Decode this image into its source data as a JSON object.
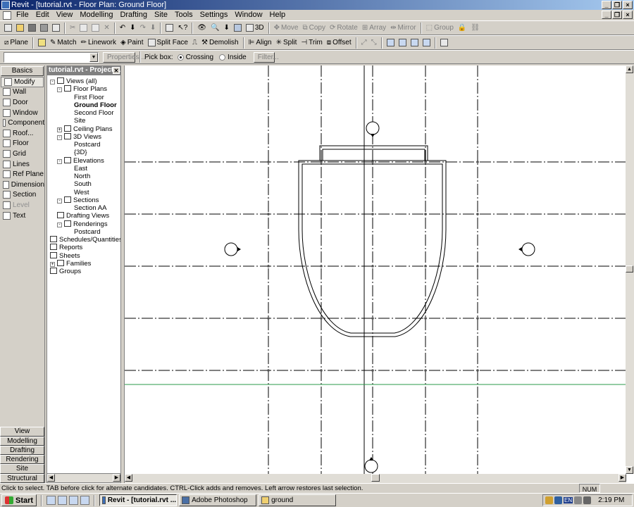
{
  "window": {
    "title": "Revit - [tutorial.rvt - Floor Plan: Ground Floor]"
  },
  "menu": [
    "File",
    "Edit",
    "View",
    "Modelling",
    "Drafting",
    "Site",
    "Tools",
    "Settings",
    "Window",
    "Help"
  ],
  "toolbar1": {
    "items": [
      "Move",
      "Copy",
      "Rotate",
      "Array",
      "Mirror",
      "Group"
    ],
    "view3d": "3D"
  },
  "toolbar2": {
    "items": [
      "Plane",
      "Match",
      "Linework",
      "Paint",
      "Split Face",
      "Demolish",
      "Align",
      "Split",
      "Trim",
      "Offset"
    ]
  },
  "optionsbar": {
    "type_selector": "",
    "properties_label": "Properties...",
    "pickbox_label": "Pick box:",
    "crossing_label": "Crossing",
    "inside_label": "Inside",
    "crossing_selected": true,
    "filter_label": "Filter..."
  },
  "design_bar": {
    "header": "Basics",
    "tools": [
      "Modify",
      "Wall",
      "Door",
      "Window",
      "Component",
      "Roof...",
      "Floor",
      "Grid",
      "Lines",
      "Ref Plane",
      "Dimension",
      "Section",
      "Level",
      "Text"
    ],
    "selected_tool": "Modify",
    "disabled_tools": [
      "Level"
    ],
    "tabs": [
      "View",
      "Modelling",
      "Drafting",
      "Rendering",
      "Site",
      "Structural"
    ]
  },
  "project_browser": {
    "title": "tutorial.rvt - Project ...",
    "tree": [
      {
        "label": "Views (all)",
        "level": 0,
        "toggle": "-",
        "active": false
      },
      {
        "label": "Floor Plans",
        "level": 1,
        "toggle": "-",
        "active": false
      },
      {
        "label": "First Floor",
        "level": 2,
        "toggle": "",
        "active": false
      },
      {
        "label": "Ground Floor",
        "level": 2,
        "toggle": "",
        "active": true
      },
      {
        "label": "Second Floor",
        "level": 2,
        "toggle": "",
        "active": false
      },
      {
        "label": "Site",
        "level": 2,
        "toggle": "",
        "active": false
      },
      {
        "label": "Ceiling Plans",
        "level": 1,
        "toggle": "+",
        "active": false
      },
      {
        "label": "3D Views",
        "level": 1,
        "toggle": "-",
        "active": false
      },
      {
        "label": "Postcard",
        "level": 2,
        "toggle": "",
        "active": false
      },
      {
        "label": "{3D}",
        "level": 2,
        "toggle": "",
        "active": false
      },
      {
        "label": "Elevations",
        "level": 1,
        "toggle": "-",
        "active": false
      },
      {
        "label": "East",
        "level": 2,
        "toggle": "",
        "active": false
      },
      {
        "label": "North",
        "level": 2,
        "toggle": "",
        "active": false
      },
      {
        "label": "South",
        "level": 2,
        "toggle": "",
        "active": false
      },
      {
        "label": "West",
        "level": 2,
        "toggle": "",
        "active": false
      },
      {
        "label": "Sections",
        "level": 1,
        "toggle": "-",
        "active": false
      },
      {
        "label": "Section AA",
        "level": 2,
        "toggle": "",
        "active": false
      },
      {
        "label": "Drafting Views",
        "level": 1,
        "toggle": "",
        "active": false
      },
      {
        "label": "Renderings",
        "level": 1,
        "toggle": "-",
        "active": false
      },
      {
        "label": "Postcard",
        "level": 2,
        "toggle": "",
        "active": false
      },
      {
        "label": "Schedules/Quantities",
        "level": 0,
        "toggle": "",
        "active": false
      },
      {
        "label": "Reports",
        "level": 0,
        "toggle": "",
        "active": false
      },
      {
        "label": "Sheets",
        "level": 0,
        "toggle": "",
        "active": false
      },
      {
        "label": "Families",
        "level": 0,
        "toggle": "+",
        "active": false
      },
      {
        "label": "Groups",
        "level": 0,
        "toggle": "",
        "active": false
      }
    ]
  },
  "status": {
    "message": "Click to select. TAB before click for alternate candidates. CTRL-Click adds and removes. Left arrow restores last selection.",
    "num": "NUM"
  },
  "taskbar": {
    "start": "Start",
    "buttons": [
      {
        "label": "Revit - [tutorial.rvt ...",
        "active": true
      },
      {
        "label": "Adobe Photoshop",
        "active": false
      },
      {
        "label": "ground",
        "active": false
      }
    ],
    "lang": "EN",
    "time": "2:19 PM"
  }
}
